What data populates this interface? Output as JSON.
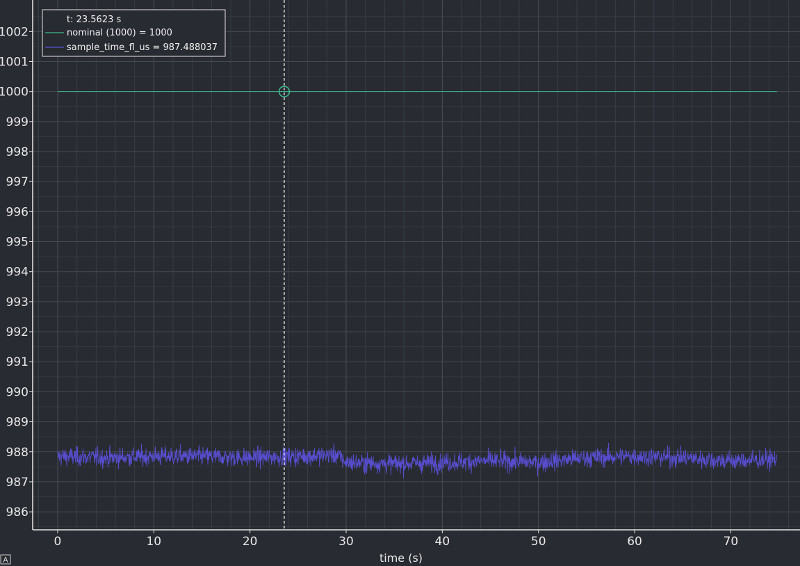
{
  "chart_data": {
    "type": "line",
    "xlabel": "time (s)",
    "ylabel": "",
    "xlim": [
      -2.6,
      77.2
    ],
    "ylim": [
      985.4,
      1003.05
    ],
    "x_ticks": [
      0,
      10,
      20,
      30,
      40,
      50,
      60,
      70
    ],
    "y_ticks": [
      986,
      987,
      988,
      989,
      990,
      991,
      992,
      993,
      994,
      995,
      996,
      997,
      998,
      999,
      1000,
      1001,
      1002
    ],
    "x_tick_labels": [
      "0",
      "10",
      "20",
      "30",
      "40",
      "50",
      "60",
      "70"
    ],
    "y_tick_labels": [
      "986",
      "987",
      "988",
      "989",
      "990",
      "991",
      "992",
      "993",
      "994",
      "995",
      "996",
      "997",
      "998",
      "999",
      "1000",
      "1001",
      "1002"
    ],
    "grid": true,
    "legend_position": "top-left",
    "cursor": {
      "t": 23.5623,
      "label": "t: 23.5623 s",
      "marker_series": "nominal (1000)",
      "marker_value": 1000
    },
    "series": [
      {
        "name": "nominal (1000)",
        "legend_label": "nominal (1000) = 1000",
        "color": "#3fb68b",
        "x_range": [
          0,
          74.8
        ],
        "value": 1000
      },
      {
        "name": "sample_time_fl_us",
        "legend_label": "sample_time_fl_us = 987.488037",
        "color": "#5a4fd6",
        "x_range": [
          0,
          74.8
        ],
        "mean_profile": {
          "x": [
            0,
            5,
            10,
            15,
            20,
            25,
            29,
            30,
            35,
            40,
            45,
            50,
            55,
            60,
            65,
            70,
            74.8
          ],
          "y": [
            987.85,
            987.8,
            987.85,
            987.85,
            987.8,
            987.85,
            987.9,
            987.65,
            987.6,
            987.65,
            987.7,
            987.65,
            987.8,
            987.85,
            987.8,
            987.7,
            987.75
          ]
        },
        "band": [
          986.65,
          989.0
        ]
      }
    ]
  }
}
